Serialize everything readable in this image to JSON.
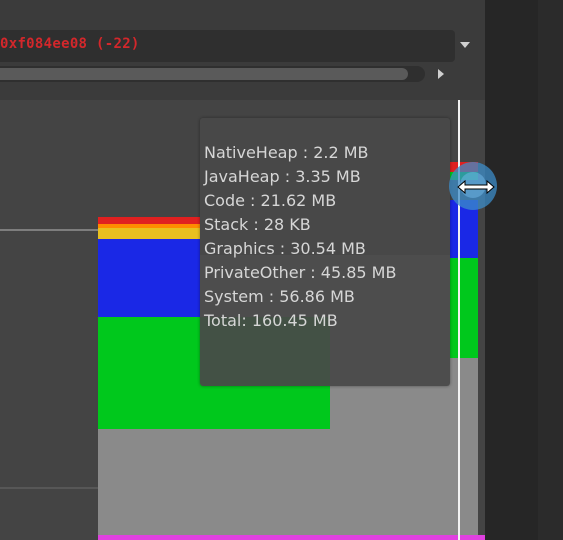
{
  "header": {
    "address_text": "0xf084ee08 (-22)"
  },
  "tooltip": {
    "lines": [
      "NativeHeap : 2.2 MB",
      "JavaHeap : 3.35 MB",
      "Code : 21.62 MB",
      "Stack : 28 KB",
      "Graphics : 30.54 MB",
      "PrivateOther : 45.85 MB",
      "System : 56.86 MB",
      "Total: 160.45 MB"
    ]
  },
  "chart_data": {
    "type": "area",
    "stacked": true,
    "series": [
      {
        "name": "System",
        "value_mb": 56.86,
        "color": "#8a8a8a"
      },
      {
        "name": "PrivateOther",
        "value_mb": 45.85,
        "color": "#00c81c"
      },
      {
        "name": "Graphics",
        "value_mb": 30.54,
        "color": "#1a28e6"
      },
      {
        "name": "Stack",
        "value_kb": 28,
        "color": "#ffffff"
      },
      {
        "name": "Code",
        "value_mb": 21.62,
        "color": "#e8c020"
      },
      {
        "name": "JavaHeap",
        "value_mb": 3.35,
        "color": "#ff8a00"
      },
      {
        "name": "NativeHeap",
        "value_mb": 2.2,
        "color": "#e02020"
      }
    ]
  },
  "colors": {
    "address_red": "#d3272b",
    "pink_baseline": "#e040e0",
    "cursor_blue": "#3c8cc8"
  },
  "icons": {
    "dropdown": "chevron-down-icon",
    "scroll_right": "arrow-right-icon",
    "cursor": "resize-horizontal-icon"
  }
}
